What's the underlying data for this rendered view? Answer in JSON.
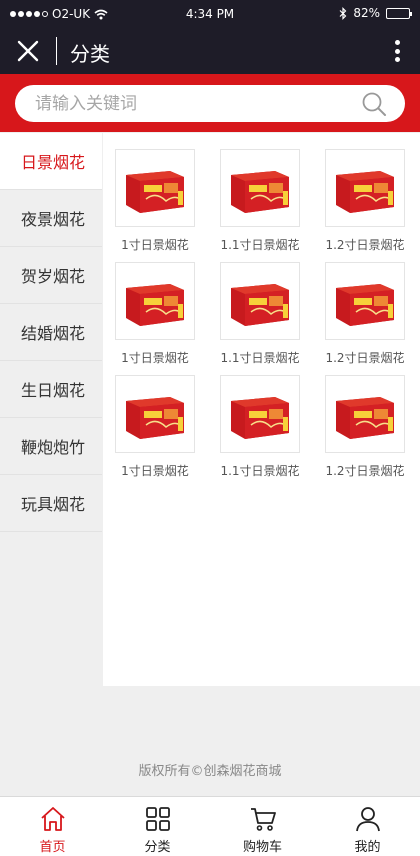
{
  "status_bar": {
    "carrier": "O2-UK",
    "time": "4:34 PM",
    "battery": "82%",
    "battery_level": 0.82
  },
  "header": {
    "title": "分类",
    "close_icon": "close-icon",
    "more_icon": "more-vertical-icon"
  },
  "search": {
    "placeholder": "请输入关键词",
    "icon": "search-icon"
  },
  "sidebar": {
    "items": [
      {
        "label": "日景烟花",
        "active": true
      },
      {
        "label": "夜景烟花",
        "active": false
      },
      {
        "label": "贺岁烟花",
        "active": false
      },
      {
        "label": "结婚烟花",
        "active": false
      },
      {
        "label": "生日烟花",
        "active": false
      },
      {
        "label": "鞭炮炮竹",
        "active": false
      },
      {
        "label": "玩具烟花",
        "active": false
      }
    ]
  },
  "products": [
    {
      "name": "1寸日景烟花"
    },
    {
      "name": "1.1寸日景烟花"
    },
    {
      "name": "1.2寸日景烟花"
    },
    {
      "name": "1寸日景烟花"
    },
    {
      "name": "1.1寸日景烟花"
    },
    {
      "name": "1.2寸日景烟花"
    },
    {
      "name": "1寸日景烟花"
    },
    {
      "name": "1.1寸日景烟花"
    },
    {
      "name": "1.2寸日景烟花"
    }
  ],
  "footer": {
    "copyright": "版权所有©创森烟花商城"
  },
  "tabbar": {
    "items": [
      {
        "label": "首页",
        "icon": "home-icon",
        "active": true
      },
      {
        "label": "分类",
        "icon": "grid-icon",
        "active": false
      },
      {
        "label": "购物车",
        "icon": "cart-icon",
        "active": false
      },
      {
        "label": "我的",
        "icon": "user-icon",
        "active": false
      }
    ]
  },
  "colors": {
    "accent": "#d7171b",
    "header_bg": "#1e1c28"
  }
}
